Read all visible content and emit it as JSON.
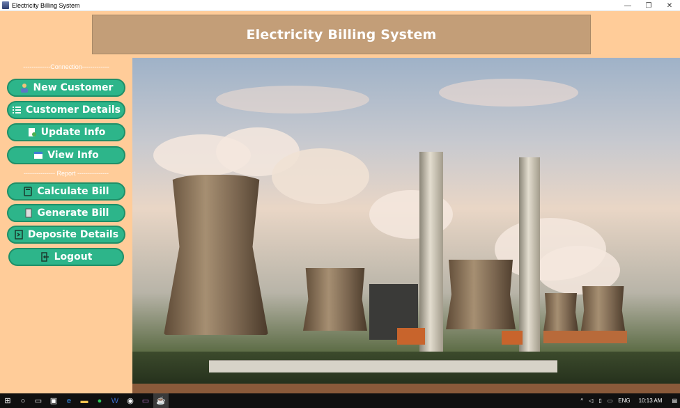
{
  "window": {
    "title": "Electricity Billing System"
  },
  "header": {
    "title": "Electricity Billing System"
  },
  "sidebar": {
    "connection_label": "-------------Connection-------------",
    "report_label": "--------------- Report ---------------",
    "items": [
      {
        "label": "New  Customer",
        "icon": "customer-icon"
      },
      {
        "label": "Customer Details",
        "icon": "list-icon"
      },
      {
        "label": "Update Info",
        "icon": "update-icon"
      },
      {
        "label": "View Info",
        "icon": "view-icon"
      },
      {
        "label": "Calculate Bill",
        "icon": "calculator-icon"
      },
      {
        "label": "Generate Bill",
        "icon": "document-icon"
      },
      {
        "label": "Deposite Details",
        "icon": "deposit-icon"
      },
      {
        "label": "Logout",
        "icon": "logout-icon"
      }
    ]
  },
  "taskbar": {
    "language": "ENG",
    "time": "10:13 AM"
  },
  "colors": {
    "background": "#ffcc99",
    "header_box": "#c39e78",
    "button": "#2db58a",
    "button_border": "#1f8f68"
  }
}
